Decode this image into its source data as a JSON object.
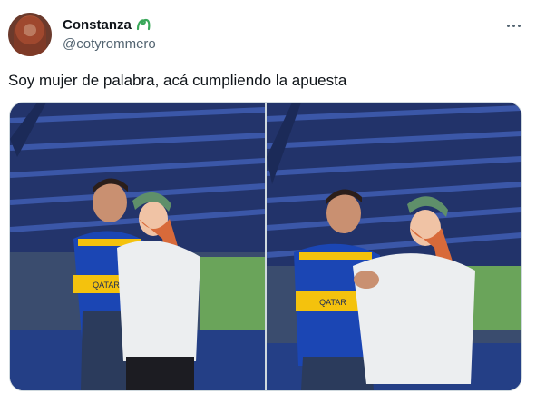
{
  "tweet": {
    "author": {
      "display_name": "Constanza",
      "handle": "@cotyrommero",
      "name_emoji": "green-clover-badge-icon",
      "avatar": "avatar"
    },
    "more_icon": "more-options-icon",
    "text": "Soy mujer de palabra, acá cumpliendo la apuesta",
    "media": {
      "photos": [
        {
          "label": "photo-1",
          "jersey_text": "QATAR Airways"
        },
        {
          "label": "photo-2",
          "jersey_text": "QATAR Airways"
        }
      ]
    }
  },
  "colors": {
    "text_primary": "#0f1419",
    "text_secondary": "#536471",
    "border": "#cfd9de",
    "stadium_blue": "#1f3a8a",
    "jersey_blue": "#1b46b4",
    "jersey_yellow": "#f4c20d",
    "cap_green": "#5f8f6a",
    "hoodie": "#e9ecef",
    "field_green": "#5f9c4a"
  }
}
